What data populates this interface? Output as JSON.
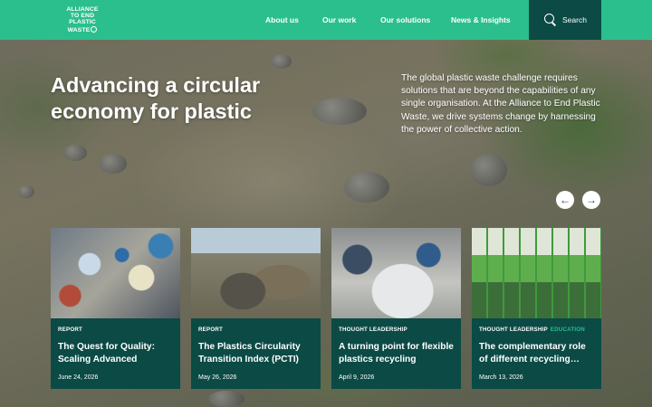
{
  "brand": {
    "logo_lines": [
      "ALLIANCE",
      "TO END",
      "PLASTIC",
      "WASTE"
    ],
    "accent": "#2bbf8d",
    "dark": "#0b4a45"
  },
  "nav": {
    "items": [
      "About us",
      "Our work",
      "Our solutions",
      "News & Insights"
    ],
    "search_label": "Search"
  },
  "hero": {
    "title": "Advancing a circular economy for plastic",
    "description": "The global plastic waste challenge requires solutions that are beyond the capabilities of any single organisation. At the Alliance to End Plastic Waste, we drive systems change by harnessing the power of collective action."
  },
  "carousel": {
    "prev_icon": "arrow-left-icon",
    "next_icon": "arrow-right-icon",
    "prev_glyph": "←",
    "next_glyph": "→"
  },
  "cards": [
    {
      "tag": "REPORT",
      "tag_extra": "",
      "title": "The Quest for Quality: Scaling Advanced Mechani…",
      "date": "June 24, 2026"
    },
    {
      "tag": "REPORT",
      "tag_extra": "",
      "title": "The Plastics Circularity Transition Index (PCTI)",
      "date": "May 26, 2026"
    },
    {
      "tag": "THOUGHT LEADERSHIP",
      "tag_extra": "",
      "title": "A turning point for flexible plastics recycling",
      "date": "April 9, 2026"
    },
    {
      "tag": "THOUGHT LEADERSHIP",
      "tag_extra": "EDUCATION",
      "title": "The complementary role of different recycling…",
      "date": "March 13, 2026"
    }
  ]
}
